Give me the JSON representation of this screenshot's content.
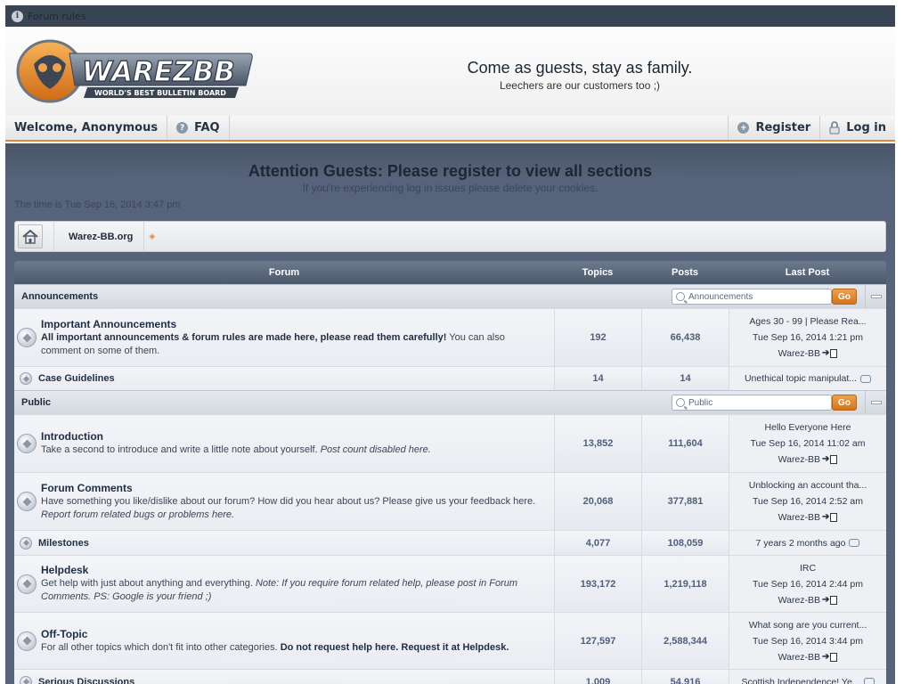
{
  "rules_bar": {
    "label": "Forum rules"
  },
  "header": {
    "logo_text": "WAREZBB",
    "logo_subtext": "WORLD'S BEST BULLETIN BOARD",
    "tagline": "Come as guests, stay as family.",
    "subtagline": "Leechers are our customers too ;)"
  },
  "nav": {
    "welcome": "Welcome, Anonymous",
    "faq": "FAQ",
    "register": "Register",
    "login": "Log in"
  },
  "notice": {
    "title": "Attention Guests: Please register to view all sections",
    "subtitle": "If you're experiencing log in issues please delete your cookies.",
    "time": "The time is Tue Sep 16, 2014 3:47 pm"
  },
  "breadcrumb": {
    "label": "Warez-BB.org"
  },
  "table": {
    "headers": {
      "forum": "Forum",
      "topics": "Topics",
      "posts": "Posts",
      "last_post": "Last Post"
    },
    "go_label": "Go",
    "categories": [
      {
        "name": "Announcements",
        "search_placeholder": "Announcements",
        "forums": [
          {
            "name": "Important Announcements",
            "desc_bold": "All important announcements & forum rules are made here, please read them carefully!",
            "desc": " You can also comment on some of them.",
            "topics": "192",
            "posts": "66,438",
            "last_title": "Ages 30 - 99 | Please Rea...",
            "last_date": "Tue Sep 16, 2014 1:21 pm",
            "last_by": "Warez-BB"
          },
          {
            "name": "Case Guidelines",
            "topics": "14",
            "posts": "14",
            "last_title": "Unethical topic manipulat..."
          }
        ]
      },
      {
        "name": "Public",
        "search_placeholder": "Public",
        "forums": [
          {
            "name": "Introduction",
            "desc": "Take a second to introduce and write a little note about yourself. ",
            "desc_italic": "Post count disabled here.",
            "topics": "13,852",
            "posts": "111,604",
            "last_title": "Hello Everyone Here",
            "last_date": "Tue Sep 16, 2014 11:02 am",
            "last_by": "Warez-BB"
          },
          {
            "name": "Forum Comments",
            "desc": "Have something you like/dislike about our forum? How did you hear about us? Please give us your feedback here. ",
            "desc_italic": "Report forum related bugs or problems here.",
            "topics": "20,068",
            "posts": "377,881",
            "last_title": "Unblocking an account tha...",
            "last_date": "Tue Sep 16, 2014 2:52 am",
            "last_by": "Warez-BB"
          },
          {
            "name": "Milestones",
            "topics": "4,077",
            "posts": "108,059",
            "last_title": "7 years 2 months ago"
          },
          {
            "name": "Helpdesk",
            "desc": "Get help with just about anything and everything. ",
            "desc_italic": "Note: If you require forum related help, please post in Forum Comments. PS: Google is your friend ;)",
            "topics": "193,172",
            "posts": "1,219,118",
            "last_title": "IRC",
            "last_date": "Tue Sep 16, 2014 2:44 pm",
            "last_by": "Warez-BB"
          },
          {
            "name": "Off-Topic",
            "desc": "For all other topics which don't fit into other categories. ",
            "desc_bold": "Do not request help here. Request it at Helpdesk.",
            "topics": "127,597",
            "posts": "2,588,344",
            "last_title": "What song are you current...",
            "last_date": "Tue Sep 16, 2014 3:44 pm",
            "last_by": "Warez-BB"
          },
          {
            "name": "Serious Discussions",
            "topics": "1,009",
            "posts": "54,916",
            "last_title": "Scottish Independence! Ye..."
          }
        ]
      }
    ]
  },
  "colors": {
    "accent": "#e2873a",
    "dark_bar": "#3a4554",
    "main_bg": "#56637a",
    "go_button": "#e08a35"
  }
}
